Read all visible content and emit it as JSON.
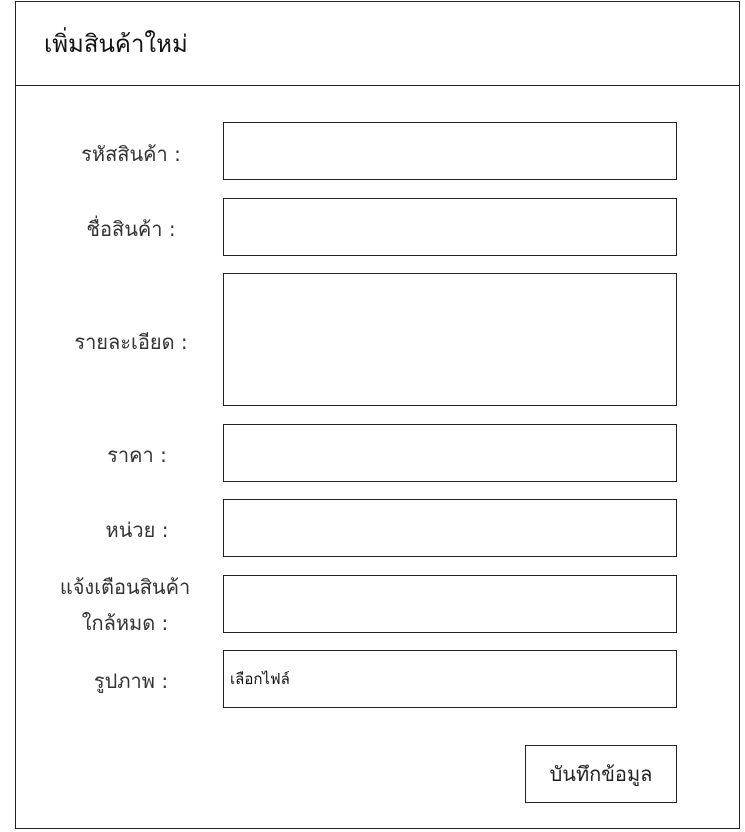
{
  "page": {
    "title": "เพิ่มสินค้าใหม่"
  },
  "form": {
    "fields": [
      {
        "label": "รหัสสินค้า :",
        "value": ""
      },
      {
        "label": "ชื่อสินค้า :",
        "value": ""
      },
      {
        "label": "รายละเอียด :",
        "value": ""
      },
      {
        "label": "ราคา :",
        "value": ""
      },
      {
        "label": "หน่วย :",
        "value": ""
      },
      {
        "label_line1": "แจ้งเตือนสินค้า",
        "label_line2": "ใกล้หมด :",
        "value": ""
      },
      {
        "label": "รูปภาพ :",
        "file_button": "เลือกไฟล์"
      }
    ],
    "submit_label": "บันทึกข้อมูล"
  }
}
